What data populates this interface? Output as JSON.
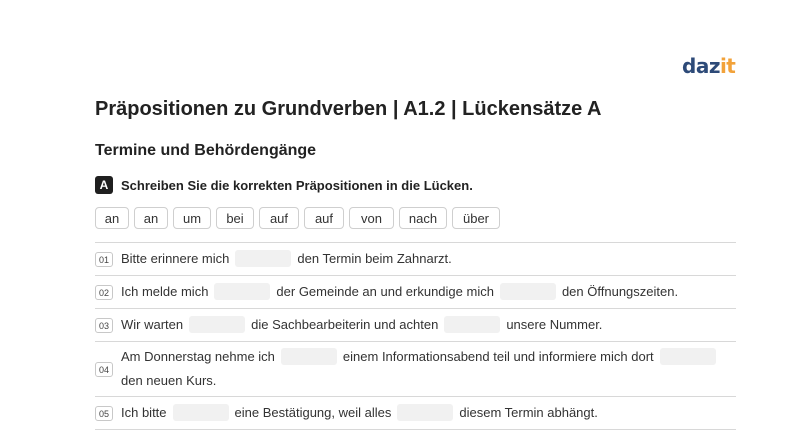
{
  "logo": {
    "part1": "daz",
    "part2": "it"
  },
  "title": "Präpositionen zu Grundverben | A1.2 | Lückensätze A",
  "subtitle": "Termine und Behördengänge",
  "task": {
    "badge": "A",
    "instruction": "Schreiben Sie die korrekten Präpositionen in die Lücken."
  },
  "word_bank": [
    "an",
    "an",
    "um",
    "bei",
    "auf",
    "auf",
    "von",
    "nach",
    "über"
  ],
  "sentences": [
    {
      "num": "01",
      "parts": [
        "Bitte erinnere mich",
        "den Termin beim Zahnarzt."
      ]
    },
    {
      "num": "02",
      "parts": [
        "Ich melde mich",
        "der Gemeinde an und erkundige mich",
        "den Öffnungszeiten."
      ]
    },
    {
      "num": "03",
      "parts": [
        "Wir warten",
        "die Sachbearbeiterin und achten",
        "unsere Nummer."
      ]
    },
    {
      "num": "04",
      "parts": [
        "Am Donnerstag nehme ich",
        "einem Informationsabend teil und informiere mich dort",
        "den neuen Kurs."
      ]
    },
    {
      "num": "05",
      "parts": [
        "Ich bitte",
        "eine Bestätigung, weil alles",
        "diesem Termin abhängt."
      ]
    }
  ]
}
